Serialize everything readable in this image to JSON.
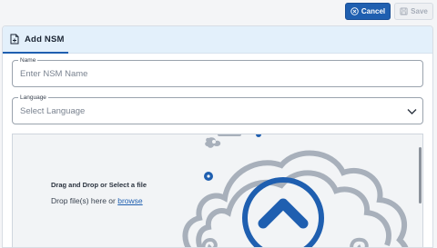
{
  "toolbar": {
    "cancel_label": "Cancel",
    "save_label": "Save"
  },
  "tab": {
    "title": "Add NSM"
  },
  "form": {
    "name": {
      "label": "Name",
      "placeholder": "Enter NSM Name"
    },
    "language": {
      "label": "Language",
      "placeholder": "Select Language"
    }
  },
  "upload": {
    "title": "Drag and Drop or Select a file",
    "hint_prefix": "Drop file(s) here or",
    "browse_link": "browse"
  },
  "colors": {
    "primary": "#1f5fb0",
    "header_bg": "#e3f0fb",
    "dropzone_bg": "#f2f4f6"
  }
}
